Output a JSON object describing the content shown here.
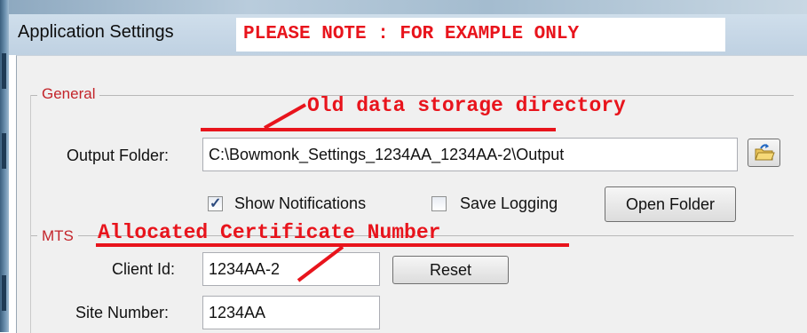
{
  "window": {
    "title": "Application Settings",
    "overlay_note": "PLEASE NOTE : FOR EXAMPLE ONLY"
  },
  "general": {
    "group_label": "General",
    "output_folder_label": "Output Folder:",
    "output_folder_value": "C:\\Bowmonk_Settings_1234AA_1234AA-2\\Output",
    "show_notifications_label": "Show Notifications",
    "show_notifications_checked": true,
    "save_logging_label": "Save Logging",
    "save_logging_checked": false,
    "open_folder_label": "Open Folder"
  },
  "mts": {
    "group_label": "MTS",
    "client_id_label": "Client Id:",
    "client_id_value": "1234AA-2",
    "reset_label": "Reset",
    "site_number_label": "Site Number:",
    "site_number_value": "1234AA"
  },
  "annotations": {
    "old_directory": "Old data storage directory",
    "certificate": "Allocated Certificate Number",
    "color": "#e8141c"
  },
  "icons": {
    "browse": "folder-browse-icon",
    "check": "checkmark-icon"
  }
}
